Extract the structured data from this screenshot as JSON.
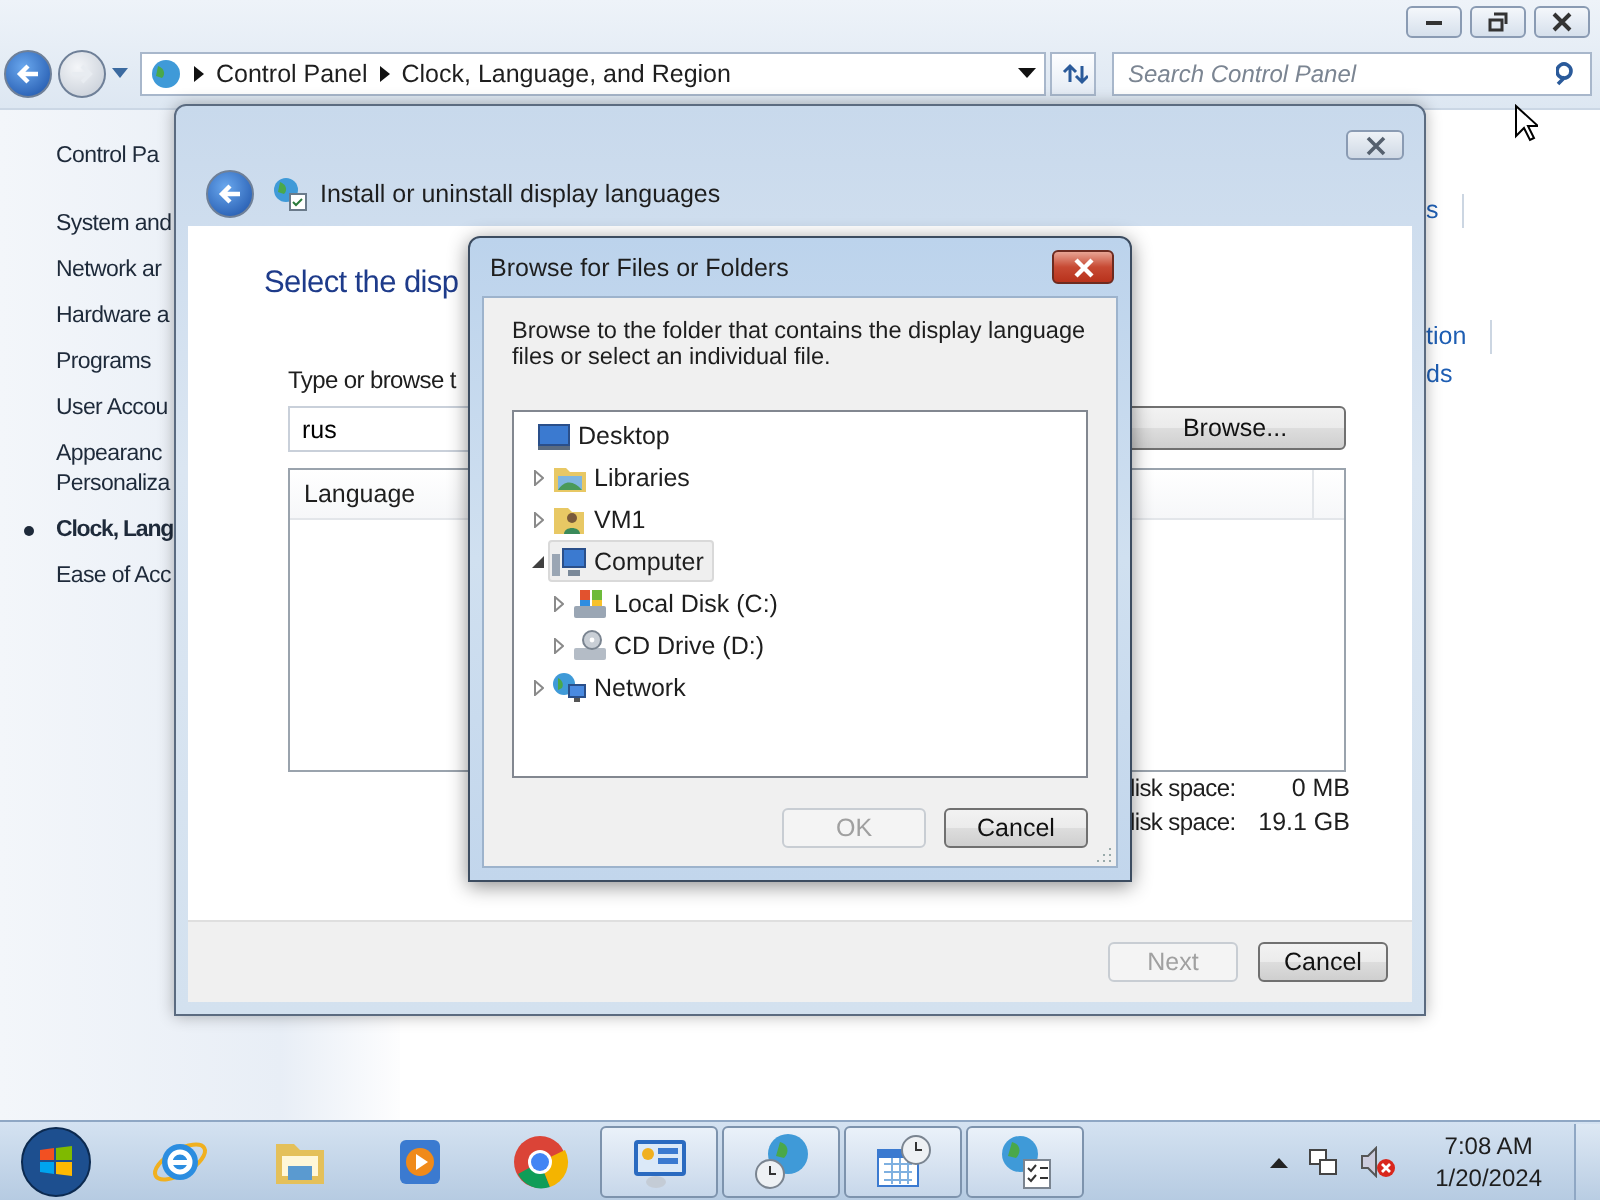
{
  "explorer": {
    "breadcrumb": [
      "Control Panel",
      "Clock, Language, and Region"
    ],
    "search": {
      "placeholder": "Search Control Panel"
    },
    "sidebar": {
      "items": [
        {
          "label": "Control Pa",
          "kind": "home",
          "selected": false
        },
        {
          "label": "System and",
          "kind": "category",
          "selected": false
        },
        {
          "label": "Network ar",
          "kind": "category",
          "selected": false
        },
        {
          "label": "Hardware a",
          "kind": "category",
          "selected": false
        },
        {
          "label": "Programs",
          "kind": "category",
          "selected": false
        },
        {
          "label": "User Accou",
          "kind": "category",
          "selected": false
        },
        {
          "label": "Appearanc\nPersonaliza",
          "kind": "category",
          "selected": false
        },
        {
          "label": "Clock, Lang",
          "kind": "category",
          "selected": true
        },
        {
          "label": "Ease of Acc",
          "kind": "category",
          "selected": false
        }
      ]
    },
    "links": [
      {
        "label": "s",
        "separator": true
      },
      {
        "label": "tion",
        "separator": true
      },
      {
        "label": "ds",
        "separator": false
      }
    ]
  },
  "install_window": {
    "title": "Install or uninstall display languages",
    "heading": "Select the disp",
    "field_label": "Type or browse t",
    "path_field": {
      "value": "rus"
    },
    "browse_button": "Browse...",
    "table": {
      "columns": [
        "Language"
      ]
    },
    "disk": [
      {
        "label": "lisk space:",
        "value": "0 MB"
      },
      {
        "label": "lisk space:",
        "value": "19.1 GB"
      }
    ],
    "buttons": [
      {
        "label": "Next",
        "disabled": true
      },
      {
        "label": "Cancel",
        "disabled": false
      }
    ]
  },
  "dialog": {
    "title": "Browse for Files or Folders",
    "description": "Browse to the folder that contains the display language files or select an individual file.",
    "tree": [
      {
        "label": "Desktop",
        "kind": "desktop",
        "selected": false,
        "children": [
          {
            "label": "Libraries",
            "kind": "library",
            "expanded": false,
            "selected": false
          },
          {
            "label": "VM1",
            "kind": "user-folder",
            "expanded": false,
            "selected": false
          },
          {
            "label": "Computer",
            "kind": "computer",
            "expanded": true,
            "selected": true,
            "children": [
              {
                "label": "Local Disk (C:)",
                "kind": "disk",
                "expanded": false,
                "selected": false
              },
              {
                "label": "CD Drive (D:)",
                "kind": "cd-drive",
                "expanded": false,
                "selected": false
              }
            ]
          },
          {
            "label": "Network",
            "kind": "network",
            "expanded": false,
            "selected": false
          }
        ]
      }
    ],
    "buttons": [
      {
        "label": "OK",
        "disabled": true
      },
      {
        "label": "Cancel",
        "disabled": false
      }
    ]
  },
  "taskbar": {
    "items": [
      {
        "kind": "ie",
        "open": false
      },
      {
        "kind": "folder",
        "open": false
      },
      {
        "kind": "media",
        "open": false
      },
      {
        "kind": "chrome",
        "open": false
      },
      {
        "kind": "control-panel",
        "open": true
      },
      {
        "kind": "globe-clock",
        "open": true
      },
      {
        "kind": "calendar-clock",
        "open": true
      },
      {
        "kind": "globe-checklist",
        "open": true
      }
    ],
    "clock": {
      "time": "7:08 AM",
      "date": "1/20/2024"
    }
  }
}
